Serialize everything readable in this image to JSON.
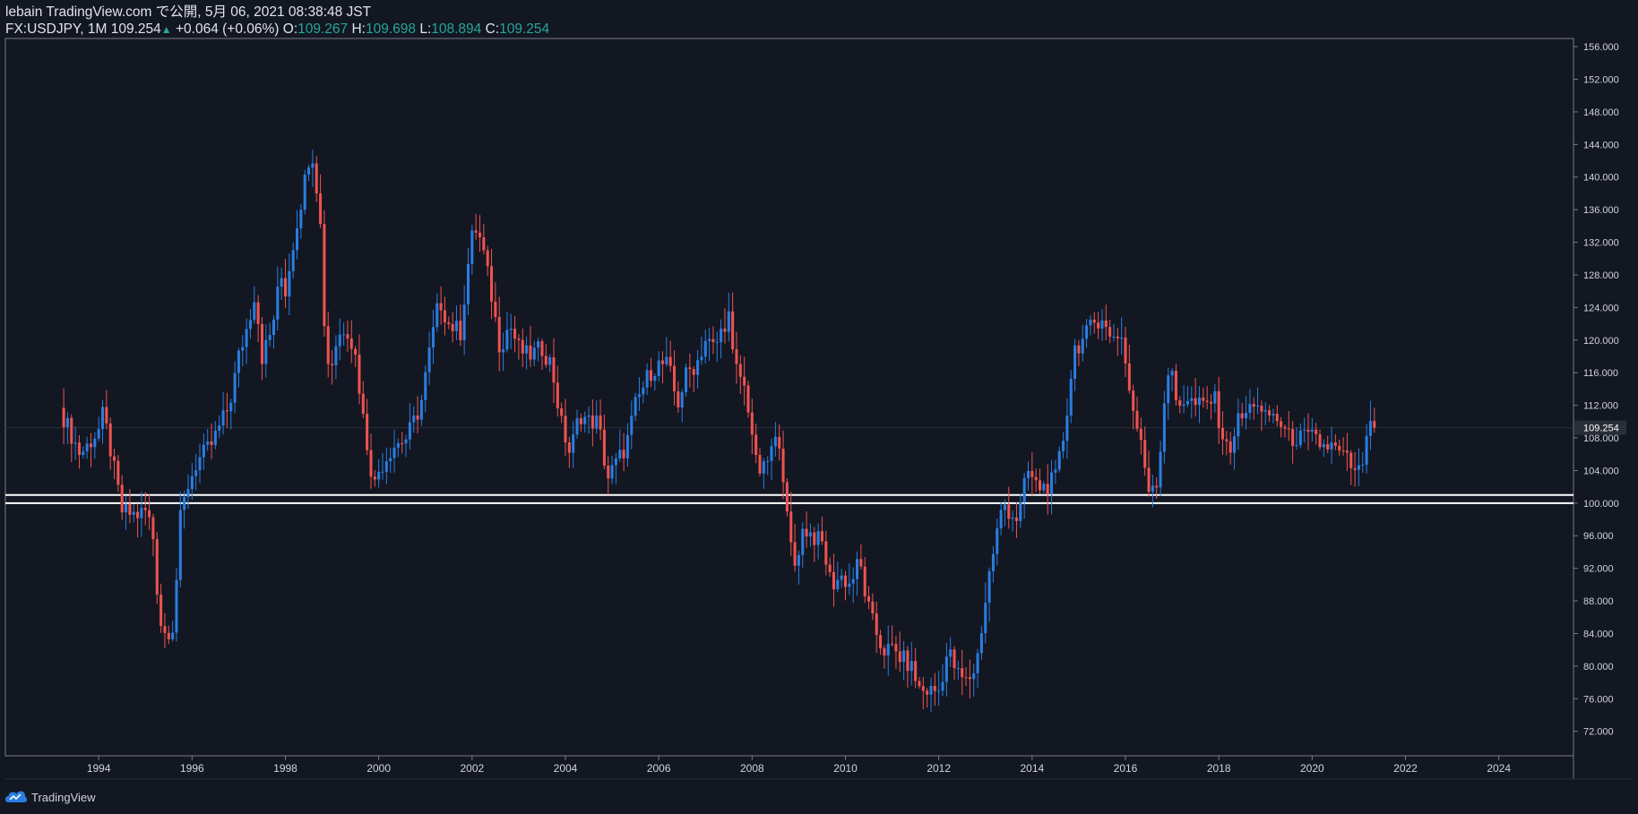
{
  "header": {
    "publish_line": "lebain TradingView.com で公開, 5月 06, 2021 08:38:48 JST",
    "symbol": "FX:USDJPY, 1M",
    "last": "109.254",
    "change": "+0.064 (+0.06%)",
    "o_label": "O:",
    "o_value": "109.267",
    "h_label": "H:",
    "h_value": "109.698",
    "l_label": "L:",
    "l_value": "108.894",
    "c_label": "C:",
    "c_value": "109.254"
  },
  "footer": {
    "brand": "TradingView"
  },
  "colors": {
    "background": "#131722",
    "up": "#2a7de1",
    "down": "#ef5350",
    "accent": "#26a69a",
    "grid": "#2a2e39"
  },
  "chart_data": {
    "type": "candlestick",
    "interval": "1M",
    "symbol": "FX:USDJPY",
    "last_price": 109.254,
    "last_price_label": "109.254",
    "ylim": [
      69,
      157
    ],
    "xlim": [
      1992.0,
      2025.6
    ],
    "y_ticks": [
      "156.000",
      "152.000",
      "148.000",
      "144.000",
      "140.000",
      "136.000",
      "132.000",
      "128.000",
      "124.000",
      "120.000",
      "116.000",
      "112.000",
      "108.000",
      "104.000",
      "100.000",
      "96.000",
      "92.000",
      "88.000",
      "84.000",
      "80.000",
      "76.000",
      "72.000"
    ],
    "x_ticks": [
      "1994",
      "1996",
      "1998",
      "2000",
      "2002",
      "2004",
      "2006",
      "2008",
      "2010",
      "2012",
      "2014",
      "2016",
      "2018",
      "2020",
      "2022",
      "2024"
    ],
    "support_band": [
      100.0,
      101.0
    ],
    "close_path": [
      [
        1993.25,
        110.5
      ],
      [
        1993.6,
        106
      ],
      [
        1993.75,
        107
      ],
      [
        1994.0,
        109
      ],
      [
        1994.1,
        111
      ],
      [
        1994.3,
        105
      ],
      [
        1994.5,
        99
      ],
      [
        1994.8,
        98.5
      ],
      [
        1995.0,
        99
      ],
      [
        1995.15,
        97
      ],
      [
        1995.3,
        86
      ],
      [
        1995.4,
        84
      ],
      [
        1995.6,
        85
      ],
      [
        1995.75,
        98
      ],
      [
        1995.9,
        102
      ],
      [
        1996.1,
        105
      ],
      [
        1996.4,
        107
      ],
      [
        1996.8,
        112
      ],
      [
        1997.0,
        118
      ],
      [
        1997.2,
        122
      ],
      [
        1997.35,
        126
      ],
      [
        1997.5,
        118
      ],
      [
        1997.7,
        121
      ],
      [
        1997.9,
        128
      ],
      [
        1998.0,
        126
      ],
      [
        1998.2,
        133
      ],
      [
        1998.4,
        139
      ],
      [
        1998.55,
        144
      ],
      [
        1998.65,
        140
      ],
      [
        1998.75,
        134
      ],
      [
        1998.85,
        120
      ],
      [
        1998.95,
        116
      ],
      [
        1999.1,
        120
      ],
      [
        1999.3,
        122
      ],
      [
        1999.5,
        118
      ],
      [
        1999.7,
        109
      ],
      [
        1999.9,
        102
      ],
      [
        2000.0,
        104
      ],
      [
        2000.3,
        107
      ],
      [
        2000.6,
        108
      ],
      [
        2000.9,
        112
      ],
      [
        2001.1,
        119
      ],
      [
        2001.3,
        125
      ],
      [
        2001.5,
        122
      ],
      [
        2001.75,
        121
      ],
      [
        2001.95,
        131
      ],
      [
        2002.05,
        134
      ],
      [
        2002.2,
        132
      ],
      [
        2002.4,
        126
      ],
      [
        2002.6,
        119
      ],
      [
        2002.8,
        122
      ],
      [
        2003.0,
        119
      ],
      [
        2003.2,
        118
      ],
      [
        2003.5,
        119
      ],
      [
        2003.7,
        117
      ],
      [
        2003.9,
        110
      ],
      [
        2004.1,
        106
      ],
      [
        2004.3,
        111
      ],
      [
        2004.5,
        110
      ],
      [
        2004.7,
        110
      ],
      [
        2004.9,
        103
      ],
      [
        2005.1,
        105
      ],
      [
        2005.3,
        107
      ],
      [
        2005.5,
        112
      ],
      [
        2005.8,
        116
      ],
      [
        2006.0,
        117
      ],
      [
        2006.2,
        117
      ],
      [
        2006.4,
        112
      ],
      [
        2006.6,
        116
      ],
      [
        2006.8,
        117
      ],
      [
        2007.0,
        120
      ],
      [
        2007.2,
        119
      ],
      [
        2007.4,
        122
      ],
      [
        2007.5,
        123
      ],
      [
        2007.6,
        117
      ],
      [
        2007.8,
        115
      ],
      [
        2007.95,
        111
      ],
      [
        2008.1,
        104
      ],
      [
        2008.25,
        104
      ],
      [
        2008.45,
        107
      ],
      [
        2008.6,
        108
      ],
      [
        2008.75,
        98
      ],
      [
        2008.9,
        92
      ],
      [
        2009.1,
        97
      ],
      [
        2009.3,
        96
      ],
      [
        2009.5,
        95
      ],
      [
        2009.7,
        90
      ],
      [
        2009.9,
        91
      ],
      [
        2010.1,
        90
      ],
      [
        2010.3,
        93
      ],
      [
        2010.45,
        88
      ],
      [
        2010.6,
        85
      ],
      [
        2010.8,
        82
      ],
      [
        2011.0,
        82
      ],
      [
        2011.2,
        81
      ],
      [
        2011.4,
        80
      ],
      [
        2011.6,
        77
      ],
      [
        2011.8,
        77
      ],
      [
        2012.0,
        77
      ],
      [
        2012.2,
        82
      ],
      [
        2012.4,
        79
      ],
      [
        2012.6,
        78
      ],
      [
        2012.8,
        80
      ],
      [
        2012.95,
        86
      ],
      [
        2013.1,
        92
      ],
      [
        2013.3,
        98
      ],
      [
        2013.4,
        100
      ],
      [
        2013.5,
        99
      ],
      [
        2013.7,
        98
      ],
      [
        2013.9,
        104
      ],
      [
        2014.1,
        102
      ],
      [
        2014.3,
        102
      ],
      [
        2014.5,
        103
      ],
      [
        2014.7,
        109
      ],
      [
        2014.9,
        119
      ],
      [
        2015.1,
        120
      ],
      [
        2015.3,
        122
      ],
      [
        2015.5,
        123
      ],
      [
        2015.65,
        120
      ],
      [
        2015.8,
        121
      ],
      [
        2015.95,
        120
      ],
      [
        2016.1,
        113
      ],
      [
        2016.3,
        108
      ],
      [
        2016.5,
        102
      ],
      [
        2016.7,
        103
      ],
      [
        2016.85,
        114
      ],
      [
        2016.95,
        117
      ],
      [
        2017.1,
        112
      ],
      [
        2017.3,
        113
      ],
      [
        2017.5,
        112
      ],
      [
        2017.7,
        112
      ],
      [
        2017.9,
        113
      ],
      [
        2018.05,
        109
      ],
      [
        2018.2,
        106
      ],
      [
        2018.4,
        110
      ],
      [
        2018.6,
        111
      ],
      [
        2018.8,
        113
      ],
      [
        2018.95,
        110
      ],
      [
        2019.1,
        111
      ],
      [
        2019.3,
        110
      ],
      [
        2019.5,
        108
      ],
      [
        2019.7,
        108
      ],
      [
        2019.9,
        108
      ],
      [
        2020.05,
        108
      ],
      [
        2020.2,
        107
      ],
      [
        2020.4,
        107
      ],
      [
        2020.6,
        106
      ],
      [
        2020.8,
        105
      ],
      [
        2020.95,
        103
      ],
      [
        2021.05,
        104.5
      ],
      [
        2021.15,
        106.5
      ],
      [
        2021.25,
        110.5
      ],
      [
        2021.35,
        109.25
      ]
    ]
  }
}
